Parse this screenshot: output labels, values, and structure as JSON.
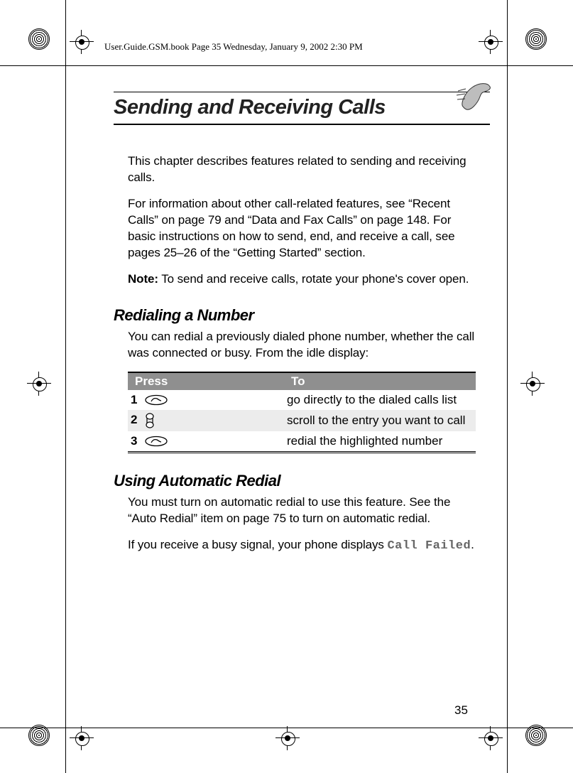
{
  "header": {
    "filename_line": "User.Guide.GSM.book  Page 35  Wednesday, January 9, 2002  2:30 PM"
  },
  "title": "Sending and Receiving Calls",
  "intro": {
    "p1": "This chapter describes features related to sending and receiving calls.",
    "p2": "For information about other call-related features, see “Recent Calls” on page 79 and “Data and Fax Calls” on page 148. For basic instructions on how to send, end, and receive a call, see pages 25–26 of the “Getting Started” section.",
    "note_label": "Note:",
    "note_text": " To send and receive calls, rotate your phone's cover open."
  },
  "sections": {
    "redial": {
      "heading": "Redialing a Number",
      "lead": "You can redial a previously dialed phone number, whether the call was connected or busy. From the idle display:",
      "table": {
        "col_press": "Press",
        "col_to": "To",
        "rows": [
          {
            "num": "1",
            "key": "send",
            "to": "go directly to the dialed calls list"
          },
          {
            "num": "2",
            "key": "scroll",
            "to": "scroll to the entry you want to call"
          },
          {
            "num": "3",
            "key": "send",
            "to": "redial the highlighted number"
          }
        ]
      }
    },
    "auto": {
      "heading": "Using Automatic Redial",
      "p1": "You must turn on automatic redial to use this feature. See the “Auto Redial” item on page 75 to turn on automatic redial.",
      "p2_pre": "If you receive a busy signal, your phone displays ",
      "p2_display": "Call Failed",
      "p2_post": "."
    }
  },
  "page_number": "35"
}
